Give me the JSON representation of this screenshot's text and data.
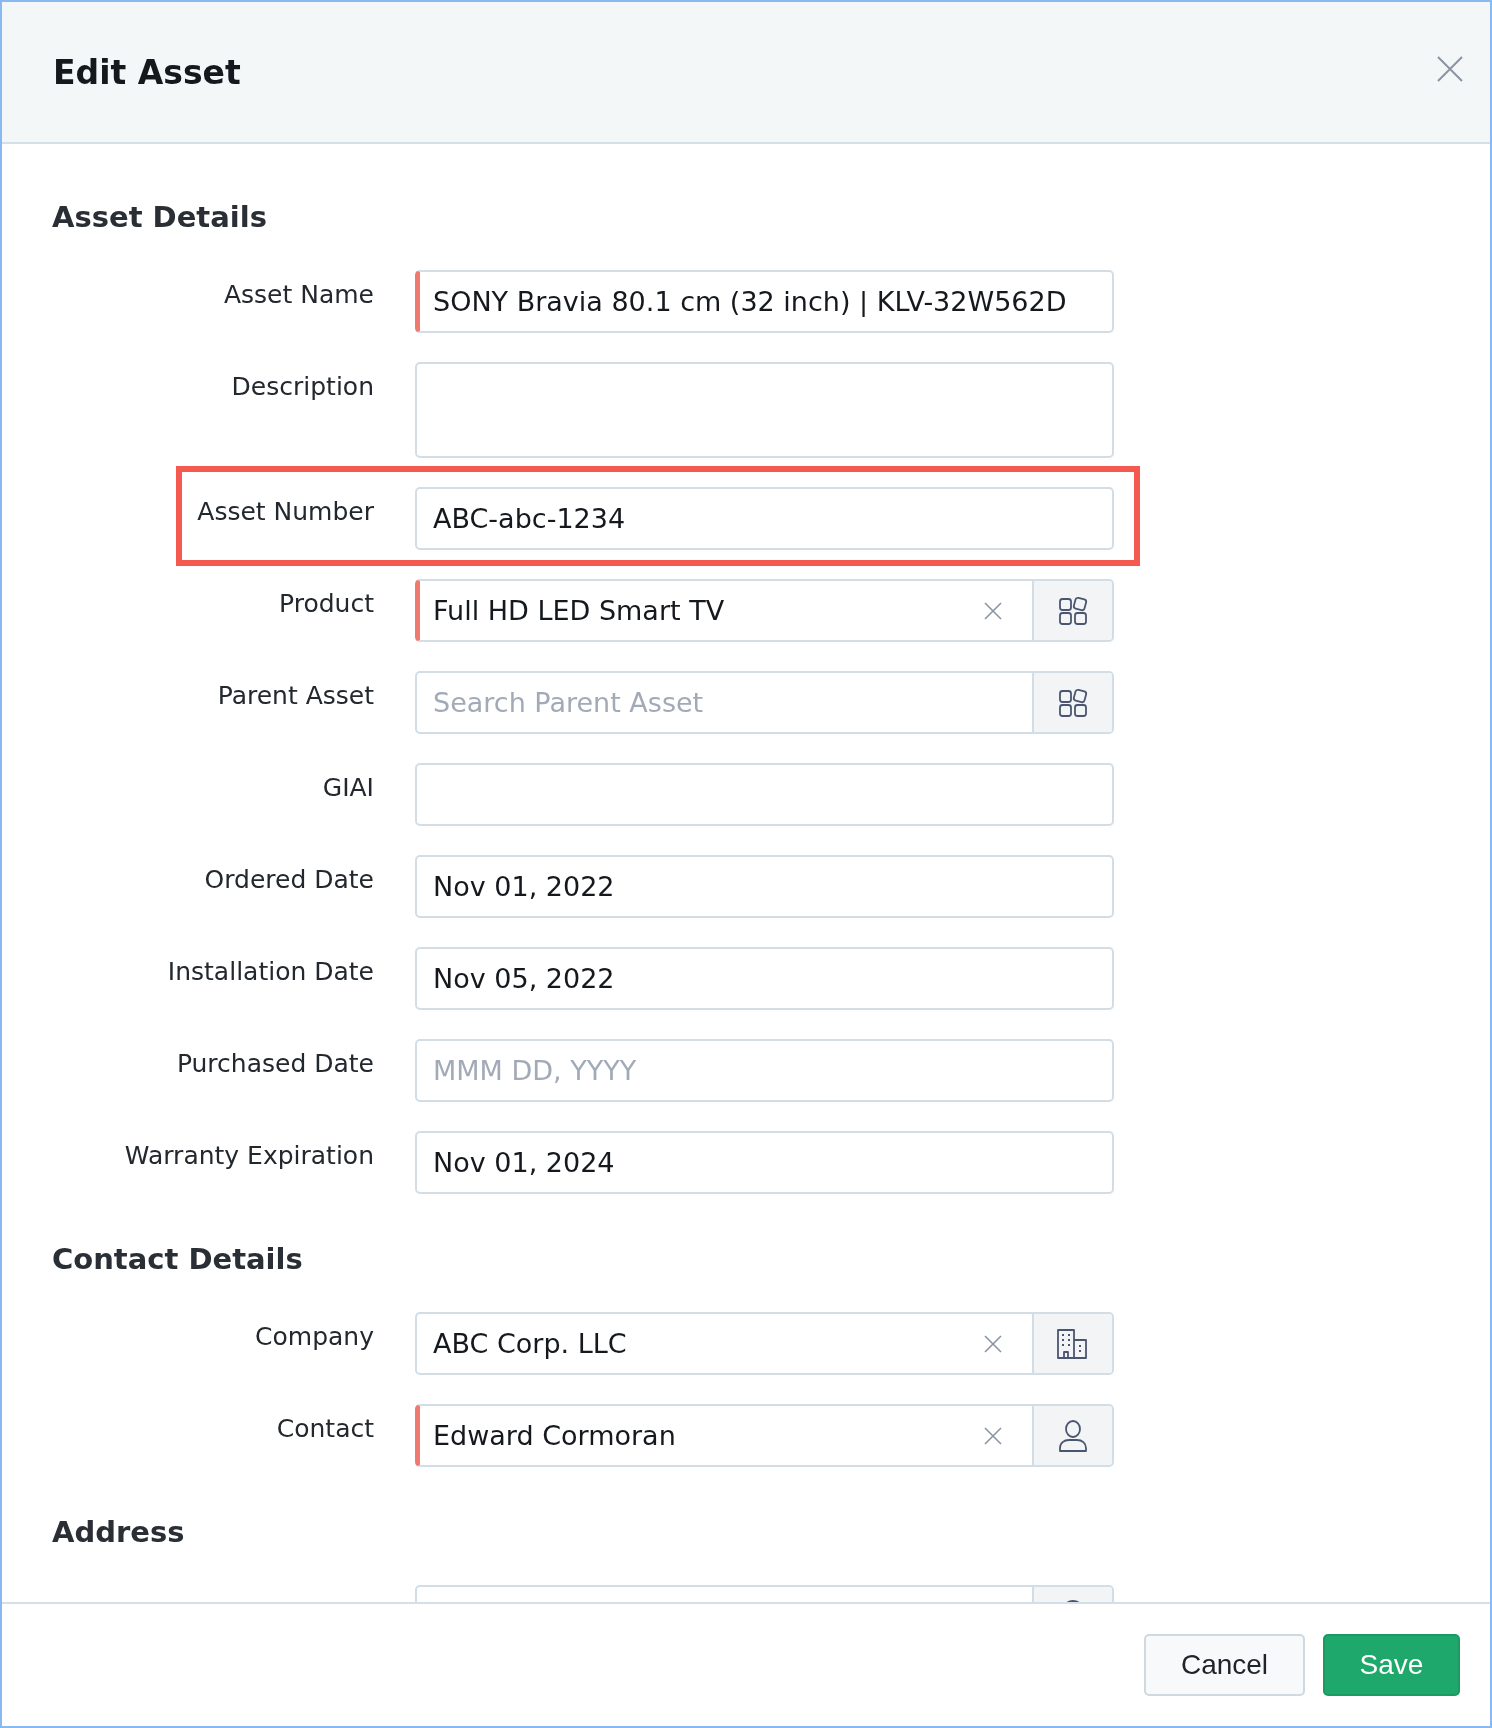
{
  "window": {
    "title": "Edit Asset"
  },
  "sections": [
    {
      "heading": "Asset Details",
      "fields": [
        {
          "label": "Asset Name",
          "kind": "text",
          "value": "SONY Bravia 80.1 cm (32 inch) | KLV-32W562D",
          "required": true,
          "highlighted": false
        },
        {
          "label": "Description",
          "kind": "textarea",
          "required": false,
          "highlighted": false
        },
        {
          "label": "Asset Number",
          "kind": "text",
          "value": "ABC-abc-1234",
          "required": false,
          "highlighted": true
        },
        {
          "label": "Product",
          "kind": "product-lookup",
          "value": "Full HD LED Smart TV",
          "clearable": true,
          "required": true,
          "highlighted": false
        },
        {
          "label": "Parent Asset",
          "kind": "product-lookup",
          "placeholder": "Search Parent Asset",
          "clearable": false,
          "required": false,
          "highlighted": false
        },
        {
          "label": "GIAI",
          "kind": "text",
          "required": false,
          "highlighted": false
        },
        {
          "label": "Ordered Date",
          "kind": "date",
          "value": "Nov 01, 2022",
          "required": false,
          "highlighted": false
        },
        {
          "label": "Installation Date",
          "kind": "date",
          "value": "Nov 05, 2022",
          "required": false,
          "highlighted": false
        },
        {
          "label": "Purchased Date",
          "kind": "date",
          "placeholder": "MMM DD, YYYY",
          "required": false,
          "highlighted": false
        },
        {
          "label": "Warranty Expiration",
          "kind": "date",
          "value": "Nov 01, 2024",
          "required": false,
          "highlighted": false
        }
      ]
    },
    {
      "heading": "Contact Details",
      "fields": [
        {
          "label": "Company",
          "kind": "company-lookup",
          "value": "ABC Corp. LLC",
          "clearable": true,
          "required": false,
          "highlighted": false
        },
        {
          "label": "Contact",
          "kind": "contact-lookup",
          "value": "Edward Cormoran",
          "clearable": true,
          "required": true,
          "highlighted": false
        }
      ]
    },
    {
      "heading": "Address",
      "fields": [
        {
          "kind": "address-lookup",
          "clearable": false,
          "required": false,
          "highlighted": false
        }
      ]
    }
  ],
  "buttons": [
    {
      "label": "Cancel",
      "kind": "secondary"
    },
    {
      "label": "Save",
      "kind": "primary"
    }
  ]
}
